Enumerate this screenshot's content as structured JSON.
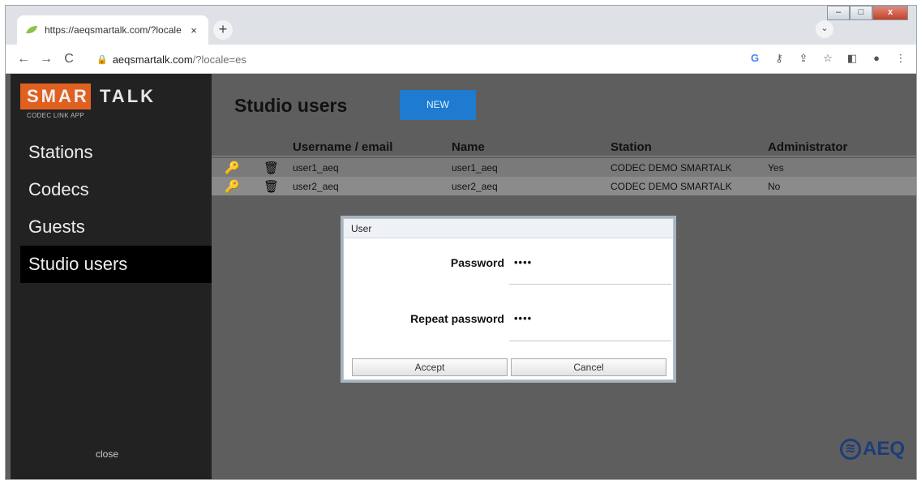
{
  "browser": {
    "tab_title": "https://aeqsmartalk.com/?locale",
    "tab_close": "×",
    "new_tab": "+",
    "tab_menu": "⌄",
    "url_domain": "aeqsmartalk.com",
    "url_path": "/?locale=es",
    "back": "←",
    "forward": "→",
    "reload": "C",
    "toolbar_icons": [
      "G",
      "⚷",
      "⇪",
      "☆",
      "◧",
      "●",
      "⋮"
    ],
    "window_buttons": [
      "–",
      "□",
      "x"
    ]
  },
  "sidebar": {
    "logo_part1": "SMAR",
    "logo_part2": "TALK",
    "logo_sub": "CODEC LINK APP",
    "items": [
      {
        "label": "Stations"
      },
      {
        "label": "Codecs"
      },
      {
        "label": "Guests"
      },
      {
        "label": "Studio users"
      }
    ],
    "active_index": 3,
    "close_label": "close"
  },
  "main": {
    "title": "Studio users",
    "new_button": "NEW",
    "columns": [
      "Username / email",
      "Name",
      "Station",
      "Administrator"
    ],
    "rows": [
      {
        "username": "user1_aeq",
        "name": "user1_aeq",
        "station": "CODEC DEMO SMARTALK",
        "admin": "Yes"
      },
      {
        "username": "user2_aeq",
        "name": "user2_aeq",
        "station": "CODEC DEMO SMARTALK",
        "admin": "No"
      }
    ],
    "key_icon": "🔑",
    "trash_icon": "🗑"
  },
  "dialog": {
    "title": "User",
    "password_label": "Password",
    "password_value": "••••",
    "repeat_label": "Repeat password",
    "repeat_value": "••••",
    "accept_label": "Accept",
    "cancel_label": "Cancel"
  },
  "footer": {
    "brand": "AEQ"
  },
  "colors": {
    "brand_orange": "#e06020",
    "button_blue": "#1e7bd0",
    "sidebar_bg": "#222222",
    "content_bg": "#5e5e5e",
    "aeq_blue": "#1c3d7a"
  }
}
